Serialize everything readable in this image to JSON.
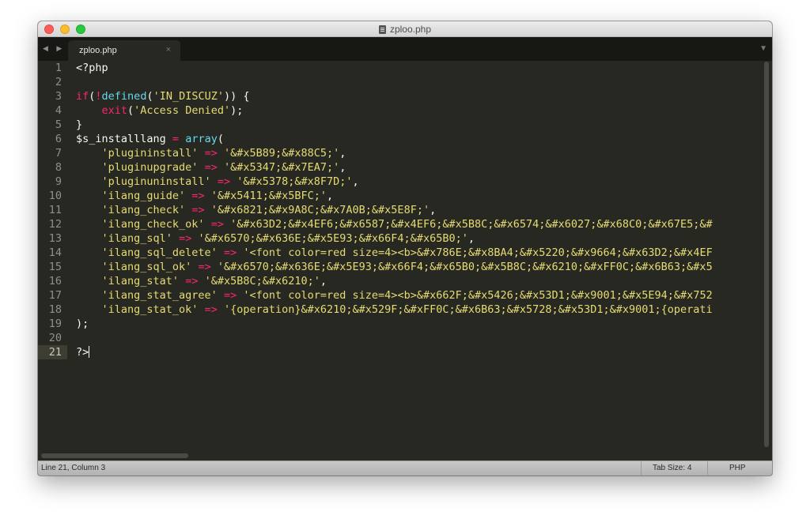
{
  "window": {
    "title": "zploo.php"
  },
  "tabs": [
    {
      "label": "zploo.php",
      "close": "×"
    }
  ],
  "tabbar": {
    "nav_arrows": "◀ ▶",
    "dropdown": "▼"
  },
  "editor": {
    "active_line": 21,
    "line_numbers": [
      "1",
      "2",
      "3",
      "4",
      "5",
      "6",
      "7",
      "8",
      "9",
      "10",
      "11",
      "12",
      "13",
      "14",
      "15",
      "16",
      "17",
      "18",
      "19",
      "20",
      "21"
    ],
    "lines": [
      "<?php",
      "",
      "if(!defined('IN_DISCUZ')) {",
      "    exit('Access Denied');",
      "}",
      "$s_installlang = array(",
      "    'plugininstall' => '&#x5B89;&#x88C5;',",
      "    'pluginupgrade' => '&#x5347;&#x7EA7;',",
      "    'pluginuninstall' => '&#x5378;&#x8F7D;',",
      "    'ilang_guide' => '&#x5411;&#x5BFC;',",
      "    'ilang_check' => '&#x6821;&#x9A8C;&#x7A0B;&#x5E8F;',",
      "    'ilang_check_ok' => '&#x63D2;&#x4EF6;&#x6587;&#x4EF6;&#x5B8C;&#x6574;&#x6027;&#x68C0;&#x67E5;&#",
      "    'ilang_sql' => '&#x6570;&#x636E;&#x5E93;&#x66F4;&#x65B0;',",
      "    'ilang_sql_delete' => '<font color=red size=4><b>&#x786E;&#x8BA4;&#x5220;&#x9664;&#x63D2;&#x4EF",
      "    'ilang_sql_ok' => '&#x6570;&#x636E;&#x5E93;&#x66F4;&#x65B0;&#x5B8C;&#x6210;&#xFF0C;&#x6B63;&#x5",
      "    'ilang_stat' => '&#x5B8C;&#x6210;',",
      "    'ilang_stat_agree' => '<font color=red size=4><b>&#x662F;&#x5426;&#x53D1;&#x9001;&#x5E94;&#x752",
      "    'ilang_stat_ok' => '{operation}&#x6210;&#x529F;&#xFF0C;&#x6B63;&#x5728;&#x53D1;&#x9001;{operati",
      ");",
      "",
      "?>"
    ]
  },
  "statusbar": {
    "position": "Line 21, Column 3",
    "tab_size": "Tab Size: 4",
    "syntax": "PHP"
  }
}
